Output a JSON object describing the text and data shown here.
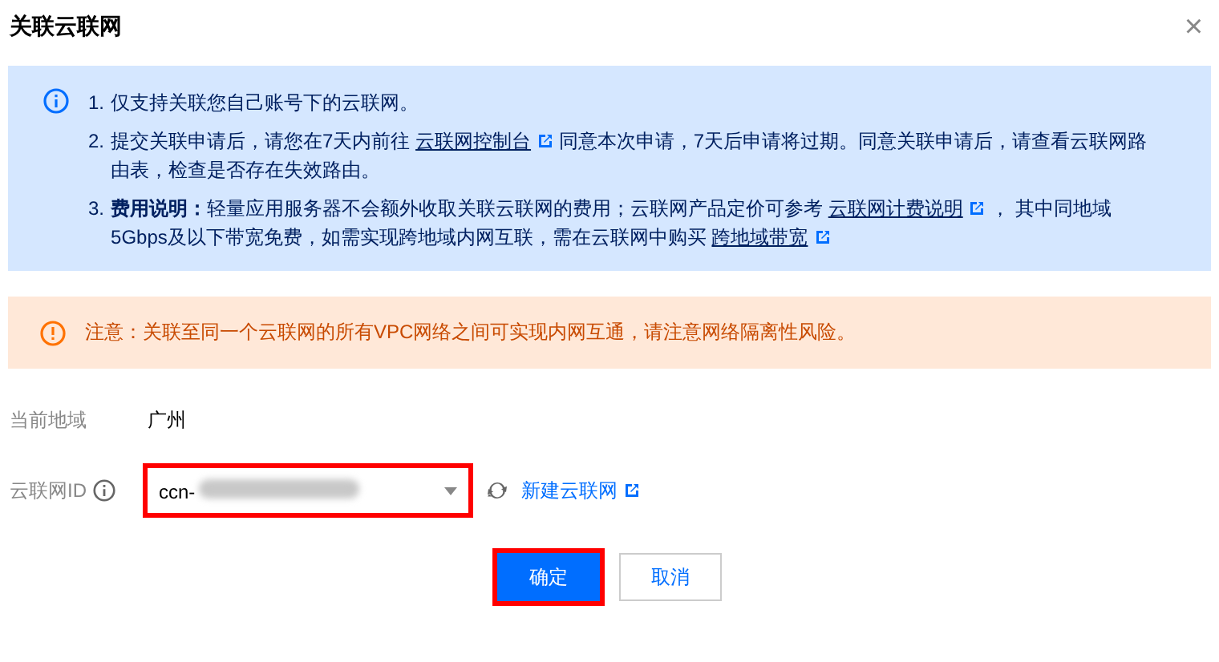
{
  "dialog": {
    "title": "关联云联网",
    "close": "×"
  },
  "info": {
    "items": [
      {
        "number": "1.",
        "parts": [
          {
            "kind": "text",
            "text": "仅支持关联您自己账号下的云联网。"
          }
        ]
      },
      {
        "number": "2.",
        "parts": [
          {
            "kind": "text",
            "text": "提交关联申请后，请您在7天内前往 "
          },
          {
            "kind": "link",
            "text": "云联网控制台"
          },
          {
            "kind": "text",
            "text": " 同意本次申请，7天后申请将过期。同意关联申请后，请查看云联网路由表，检查是否存在失效路由。"
          }
        ]
      },
      {
        "number": "3.",
        "parts": [
          {
            "kind": "bold",
            "text": "费用说明："
          },
          {
            "kind": "text",
            "text": "轻量应用服务器不会额外收取关联云联网的费用；云联网产品定价可参考 "
          },
          {
            "kind": "link",
            "text": "云联网计费说明"
          },
          {
            "kind": "text",
            "text": " ， 其中同地域5Gbps及以下带宽免费，如需实现跨地域内网互联，需在云联网中购买 "
          },
          {
            "kind": "link",
            "text": "跨地域带宽"
          }
        ]
      }
    ]
  },
  "warning": {
    "text": "注意：关联至同一个云联网的所有VPC网络之间可实现内网互通，请注意网络隔离性风险。"
  },
  "form": {
    "region_label": "当前地域",
    "region_value": "广州",
    "ccn_label": "云联网ID",
    "ccn_value": "ccn-",
    "ccn_highlighted": true,
    "create_link": "新建云联网"
  },
  "buttons": [
    {
      "label": "确定",
      "kind": "primary",
      "highlighted": true
    },
    {
      "label": "取消",
      "kind": "secondary",
      "highlighted": false
    }
  ]
}
